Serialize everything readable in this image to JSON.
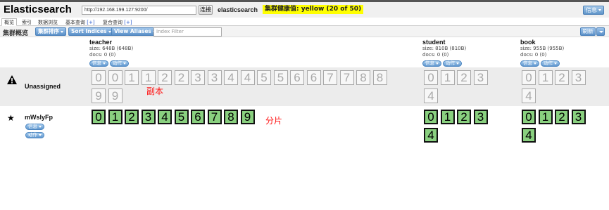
{
  "app": {
    "title": "Elasticsearch",
    "url": "http://192.168.199.127:9200/",
    "connect_label": "连接",
    "cluster_name": "elasticsearch",
    "health": "集群健康值: yellow (20 of 50)",
    "health_color": "#ffff00",
    "info_label": "信息"
  },
  "tabs": [
    {
      "label": "概览",
      "active": true
    },
    {
      "label": "索引",
      "active": false
    },
    {
      "label": "数据浏览",
      "active": false
    },
    {
      "label": "基本查询",
      "plus": "[+]",
      "active": false
    },
    {
      "label": "复合查询",
      "plus": "[+]",
      "active": false
    }
  ],
  "toolbar": {
    "title": "集群概览",
    "sort_cluster": "集群排序",
    "sort_indices": "Sort Indices",
    "view_aliases": "View Aliases",
    "filter_placeholder": "Index Filter",
    "refresh_label": "刷新"
  },
  "indices": [
    {
      "name": "teacher",
      "size": "size: 648B (648B)",
      "docs": "docs: 0 (0)",
      "info": "信息",
      "action": "动作"
    },
    {
      "name": "student",
      "size": "size: 810B (810B)",
      "docs": "docs: 0 (0)",
      "info": "信息",
      "action": "动作"
    },
    {
      "name": "book",
      "size": "size: 955B (955B)",
      "docs": "docs: 0 (0)",
      "info": "信息",
      "action": "动作"
    }
  ],
  "unassigned": {
    "label": "Unassigned",
    "teacher_shards": [
      "0",
      "0",
      "1",
      "1",
      "2",
      "2",
      "3",
      "3",
      "4",
      "4",
      "5",
      "5",
      "6",
      "6",
      "7",
      "7",
      "8",
      "8",
      "9",
      "9"
    ],
    "student_shards": [
      "0",
      "1",
      "2",
      "3",
      "4"
    ],
    "book_shards": [
      "0",
      "1",
      "2",
      "3",
      "4"
    ],
    "annotation": "副本"
  },
  "node": {
    "name": "mWslyFp",
    "info": "信息",
    "action": "动作",
    "teacher_shards": [
      "0",
      "1",
      "2",
      "3",
      "4",
      "5",
      "6",
      "7",
      "8",
      "9"
    ],
    "student_shards": [
      "0",
      "1",
      "2",
      "3",
      "4"
    ],
    "book_shards": [
      "0",
      "1",
      "2",
      "3",
      "4"
    ],
    "annotation": "分片"
  },
  "colors": {
    "primary_shard": "#89d07f",
    "replica_shard_border": "#a9a9a9",
    "annotation": "#ff1010",
    "button_blue": "#5a90c8"
  }
}
